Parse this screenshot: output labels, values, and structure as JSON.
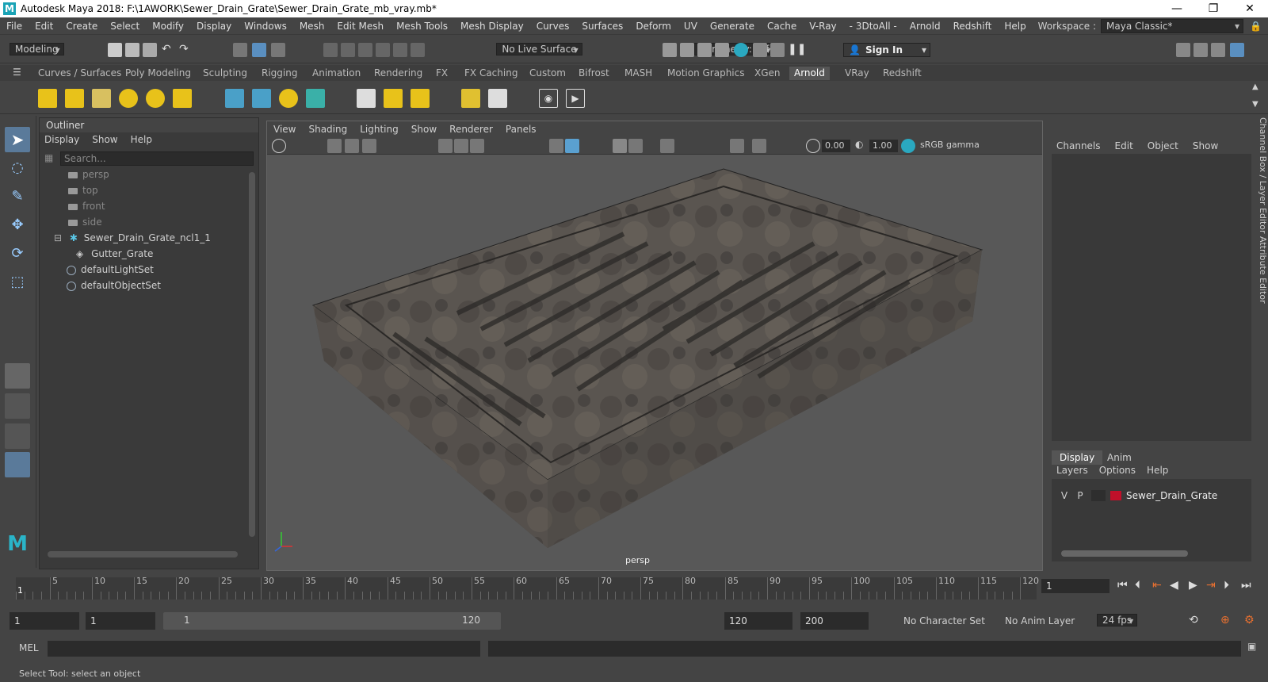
{
  "window": {
    "title": "Autodesk Maya 2018: F:\\1AWORK\\Sewer_Drain_Grate\\Sewer_Drain_Grate_mb_vray.mb*"
  },
  "menus": [
    "File",
    "Edit",
    "Create",
    "Select",
    "Modify",
    "Display",
    "Windows",
    "Mesh",
    "Edit Mesh",
    "Mesh Tools",
    "Mesh Display",
    "Curves",
    "Surfaces",
    "Deform",
    "UV",
    "Generate",
    "Cache",
    "V-Ray",
    "- 3DtoAll -",
    "Arnold",
    "Redshift",
    "Help"
  ],
  "workspace": {
    "label": "Workspace :",
    "value": "Maya Classic*"
  },
  "status": {
    "mode": "Modeling",
    "live_surface": "No Live Surface",
    "symmetry": "Symmetry: Off",
    "sign_in": "Sign In"
  },
  "shelf_tabs": [
    "Curves / Surfaces",
    "Poly Modeling",
    "Sculpting",
    "Rigging",
    "Animation",
    "Rendering",
    "FX",
    "FX Caching",
    "Custom",
    "Bifrost",
    "MASH",
    "Motion Graphics",
    "XGen",
    "Arnold",
    "VRay",
    "Redshift"
  ],
  "active_shelf": "Arnold",
  "outliner": {
    "title": "Outliner",
    "menus": [
      "Display",
      "Show",
      "Help"
    ],
    "search_placeholder": "Search...",
    "items": [
      "persp",
      "top",
      "front",
      "side",
      "Sewer_Drain_Grate_ncl1_1",
      "Gutter_Grate",
      "defaultLightSet",
      "defaultObjectSet"
    ]
  },
  "viewport": {
    "menus": [
      "View",
      "Shading",
      "Lighting",
      "Show",
      "Renderer",
      "Panels"
    ],
    "exposure": "0.00",
    "gamma": "1.00",
    "color_space": "sRGB gamma",
    "camera_label": "persp"
  },
  "channel_box": {
    "menus": [
      "Channels",
      "Edit",
      "Object",
      "Show"
    ]
  },
  "layer_editor": {
    "tabs": [
      "Display",
      "Anim"
    ],
    "menus": [
      "Layers",
      "Options",
      "Help"
    ],
    "layer": {
      "v": "V",
      "p": "P",
      "name": "Sewer_Drain_Grate",
      "color": "#c0102a"
    }
  },
  "side_tabs": "Channel Box / Layer Editor        Attribute Editor",
  "timeline": {
    "ticks": [
      "5",
      "10",
      "15",
      "20",
      "25",
      "30",
      "35",
      "40",
      "45",
      "50",
      "55",
      "60",
      "65",
      "70",
      "75",
      "80",
      "85",
      "90",
      "95",
      "100",
      "105",
      "110",
      "115",
      "120"
    ],
    "current_frame_marker": "1",
    "current_frame": "1"
  },
  "range": {
    "start": "1",
    "current": "1",
    "range_start": "1",
    "range_end": "120",
    "end": "120",
    "max": "200",
    "character_set": "No Character Set",
    "anim_layer": "No Anim Layer",
    "fps": "24 fps"
  },
  "mel": {
    "label": "MEL"
  },
  "help_line": "Select Tool: select an object"
}
